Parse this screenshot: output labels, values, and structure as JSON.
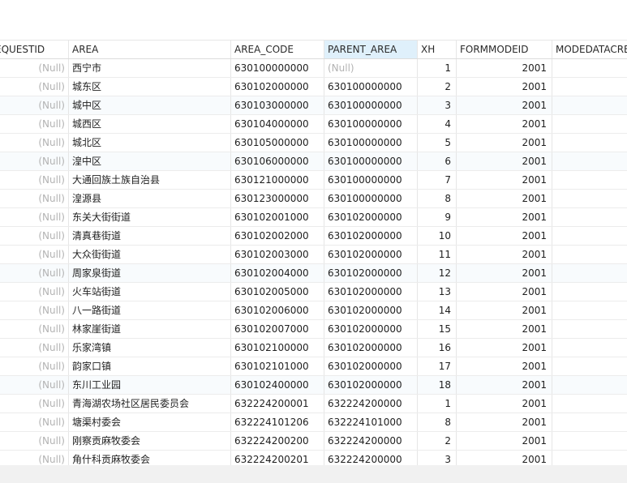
{
  "columns": {
    "requestid": "EQUESTID",
    "area": "AREA",
    "area_code": "AREA_CODE",
    "parent_area": "PARENT_AREA",
    "xh": "XH",
    "formmodeid": "FORMMODEID",
    "modedatacreate": "MODEDATACRE"
  },
  "null_text": "(Null)",
  "rows": [
    {
      "requestid": "(Null)",
      "area": "西宁市",
      "area_code": "630100000000",
      "parent_area": "(Null)",
      "xh": "1",
      "formmodeid": "2001"
    },
    {
      "requestid": "(Null)",
      "area": "城东区",
      "area_code": "630102000000",
      "parent_area": "630100000000",
      "xh": "2",
      "formmodeid": "2001"
    },
    {
      "requestid": "(Null)",
      "area": "城中区",
      "area_code": "630103000000",
      "parent_area": "630100000000",
      "xh": "3",
      "formmodeid": "2001"
    },
    {
      "requestid": "(Null)",
      "area": "城西区",
      "area_code": "630104000000",
      "parent_area": "630100000000",
      "xh": "4",
      "formmodeid": "2001"
    },
    {
      "requestid": "(Null)",
      "area": "城北区",
      "area_code": "630105000000",
      "parent_area": "630100000000",
      "xh": "5",
      "formmodeid": "2001"
    },
    {
      "requestid": "(Null)",
      "area": "湟中区",
      "area_code": "630106000000",
      "parent_area": "630100000000",
      "xh": "6",
      "formmodeid": "2001"
    },
    {
      "requestid": "(Null)",
      "area": "大通回族土族自治县",
      "area_code": "630121000000",
      "parent_area": "630100000000",
      "xh": "7",
      "formmodeid": "2001"
    },
    {
      "requestid": "(Null)",
      "area": "湟源县",
      "area_code": "630123000000",
      "parent_area": "630100000000",
      "xh": "8",
      "formmodeid": "2001"
    },
    {
      "requestid": "(Null)",
      "area": "东关大街街道",
      "area_code": "630102001000",
      "parent_area": "630102000000",
      "xh": "9",
      "formmodeid": "2001"
    },
    {
      "requestid": "(Null)",
      "area": "清真巷街道",
      "area_code": "630102002000",
      "parent_area": "630102000000",
      "xh": "10",
      "formmodeid": "2001"
    },
    {
      "requestid": "(Null)",
      "area": "大众街街道",
      "area_code": "630102003000",
      "parent_area": "630102000000",
      "xh": "11",
      "formmodeid": "2001"
    },
    {
      "requestid": "(Null)",
      "area": "周家泉街道",
      "area_code": "630102004000",
      "parent_area": "630102000000",
      "xh": "12",
      "formmodeid": "2001"
    },
    {
      "requestid": "(Null)",
      "area": "火车站街道",
      "area_code": "630102005000",
      "parent_area": "630102000000",
      "xh": "13",
      "formmodeid": "2001"
    },
    {
      "requestid": "(Null)",
      "area": "八一路街道",
      "area_code": "630102006000",
      "parent_area": "630102000000",
      "xh": "14",
      "formmodeid": "2001"
    },
    {
      "requestid": "(Null)",
      "area": "林家崖街道",
      "area_code": "630102007000",
      "parent_area": "630102000000",
      "xh": "15",
      "formmodeid": "2001"
    },
    {
      "requestid": "(Null)",
      "area": "乐家湾镇",
      "area_code": "630102100000",
      "parent_area": "630102000000",
      "xh": "16",
      "formmodeid": "2001"
    },
    {
      "requestid": "(Null)",
      "area": "韵家口镇",
      "area_code": "630102101000",
      "parent_area": "630102000000",
      "xh": "17",
      "formmodeid": "2001"
    },
    {
      "requestid": "(Null)",
      "area": "东川工业园",
      "area_code": "630102400000",
      "parent_area": "630102000000",
      "xh": "18",
      "formmodeid": "2001"
    },
    {
      "requestid": "(Null)",
      "area": "青海湖农场社区居民委员会",
      "area_code": "632224200001",
      "parent_area": "632224200000",
      "xh": "1",
      "formmodeid": "2001"
    },
    {
      "requestid": "(Null)",
      "area": "塘渠村委会",
      "area_code": "632224101206",
      "parent_area": "632224101000",
      "xh": "8",
      "formmodeid": "2001"
    },
    {
      "requestid": "(Null)",
      "area": "刚察贡麻牧委会",
      "area_code": "632224200200",
      "parent_area": "632224200000",
      "xh": "2",
      "formmodeid": "2001"
    },
    {
      "requestid": "(Null)",
      "area": "角什科贡麻牧委会",
      "area_code": "632224200201",
      "parent_area": "632224200000",
      "xh": "3",
      "formmodeid": "2001"
    }
  ],
  "colors": {
    "null_text": "#b3b3b3",
    "selected_header": "#dff0fb",
    "alt_row": "#f8fbfd"
  }
}
